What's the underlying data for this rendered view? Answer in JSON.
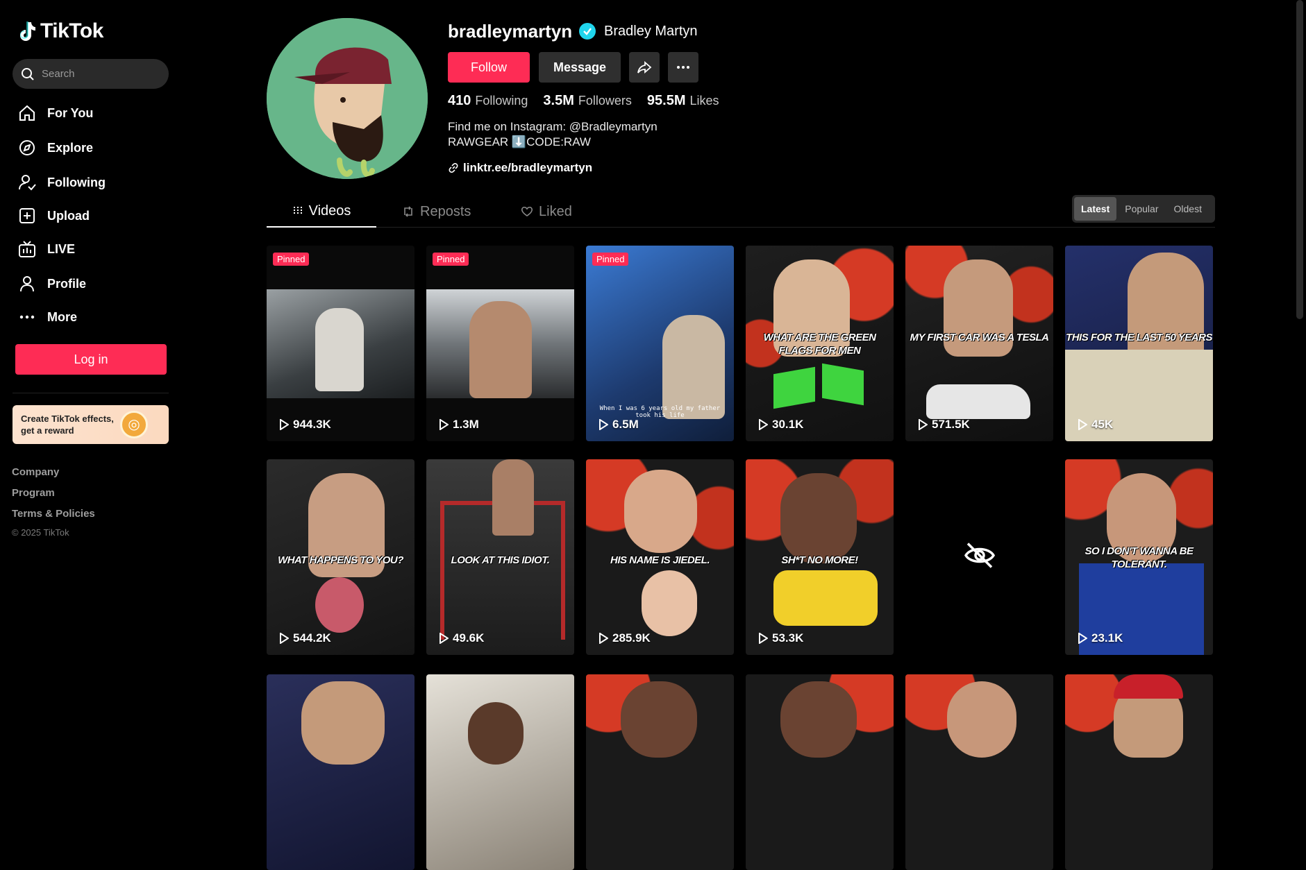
{
  "app": {
    "logo_text": "TikTok"
  },
  "sidebar": {
    "search_placeholder": "Search",
    "nav": [
      {
        "label": "For You",
        "icon": "home-icon"
      },
      {
        "label": "Explore",
        "icon": "compass-icon"
      },
      {
        "label": "Following",
        "icon": "following-icon"
      },
      {
        "label": "Upload",
        "icon": "upload-icon"
      },
      {
        "label": "LIVE",
        "icon": "live-icon"
      },
      {
        "label": "Profile",
        "icon": "profile-icon"
      },
      {
        "label": "More",
        "icon": "more-icon"
      }
    ],
    "login_label": "Log in",
    "effects_text": "Create TikTok effects, get a reward",
    "footer": {
      "company": "Company",
      "program": "Program",
      "terms": "Terms & Policies",
      "copyright": "© 2025 TikTok"
    }
  },
  "profile": {
    "username": "bradleymartyn",
    "display_name": "Bradley Martyn",
    "follow_label": "Follow",
    "message_label": "Message",
    "stats": [
      {
        "value": "410",
        "label": "Following"
      },
      {
        "value": "3.5M",
        "label": "Followers"
      },
      {
        "value": "95.5M",
        "label": "Likes"
      }
    ],
    "bio_line1": "Find me on Instagram: @Bradleymartyn",
    "bio_line2": "RAWGEAR ⬇️CODE:RAW",
    "link": "linktr.ee/bradleymartyn"
  },
  "tabs": [
    {
      "label": "Videos",
      "active": true
    },
    {
      "label": "Reposts",
      "active": false
    },
    {
      "label": "Liked",
      "active": false
    }
  ],
  "sort": {
    "options": [
      "Latest",
      "Popular",
      "Oldest"
    ],
    "selected": "Latest"
  },
  "pinned_label": "Pinned",
  "videos": [
    {
      "views": "944.3K",
      "pinned": true,
      "caption": ""
    },
    {
      "views": "1.3M",
      "pinned": true,
      "caption": ""
    },
    {
      "views": "6.5M",
      "pinned": true,
      "caption": "When I was 6 years old my father took his life"
    },
    {
      "views": "30.1K",
      "pinned": false,
      "caption": "WHAT ARE THE GREEN FLAGS FOR MEN"
    },
    {
      "views": "571.5K",
      "pinned": false,
      "caption": "MY FIRST CAR WAS A TESLA"
    },
    {
      "views": "45K",
      "pinned": false,
      "caption": "THIS FOR THE LAST 50 YEARS"
    },
    {
      "views": "544.2K",
      "pinned": false,
      "caption": "WHAT HAPPENS TO YOU?"
    },
    {
      "views": "49.6K",
      "pinned": false,
      "caption": "LOOK AT THIS IDIOT."
    },
    {
      "views": "285.9K",
      "pinned": false,
      "caption": "HIS NAME IS JIEDEL."
    },
    {
      "views": "53.3K",
      "pinned": false,
      "caption": "SH*T NO MORE!"
    },
    {
      "views": "",
      "pinned": false,
      "caption": ""
    },
    {
      "views": "23.1K",
      "pinned": false,
      "caption": "SO I DON'T WANNA BE TOLERANT."
    }
  ],
  "colors": {
    "accent": "#fe2c55",
    "verified": "#20d5ec",
    "background": "#000000"
  }
}
